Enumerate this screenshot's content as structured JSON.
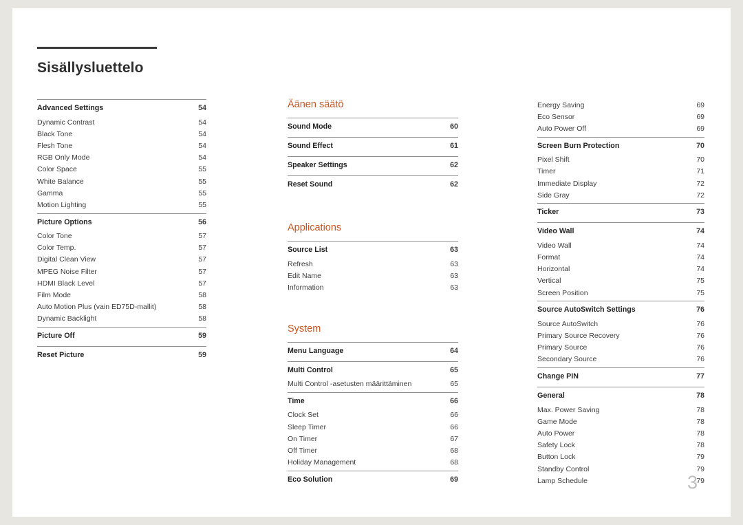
{
  "document": {
    "title": "Sisällysluettelo",
    "page_number": "3"
  },
  "columns": [
    {
      "sections": [
        {
          "heading": null,
          "blocks": [
            {
              "rows": [
                {
                  "label": "Advanced Settings",
                  "page": "54",
                  "bold": true
                },
                {
                  "label": "Dynamic Contrast",
                  "page": "54",
                  "bold": false
                },
                {
                  "label": "Black Tone",
                  "page": "54",
                  "bold": false
                },
                {
                  "label": "Flesh Tone",
                  "page": "54",
                  "bold": false
                },
                {
                  "label": "RGB Only Mode",
                  "page": "54",
                  "bold": false
                },
                {
                  "label": "Color Space",
                  "page": "55",
                  "bold": false
                },
                {
                  "label": "White Balance",
                  "page": "55",
                  "bold": false
                },
                {
                  "label": "Gamma",
                  "page": "55",
                  "bold": false
                },
                {
                  "label": "Motion Lighting",
                  "page": "55",
                  "bold": false
                }
              ]
            },
            {
              "rows": [
                {
                  "label": "Picture Options",
                  "page": "56",
                  "bold": true
                },
                {
                  "label": "Color Tone",
                  "page": "57",
                  "bold": false
                },
                {
                  "label": "Color Temp.",
                  "page": "57",
                  "bold": false
                },
                {
                  "label": "Digital Clean View",
                  "page": "57",
                  "bold": false
                },
                {
                  "label": "MPEG Noise Filter",
                  "page": "57",
                  "bold": false
                },
                {
                  "label": "HDMI Black Level",
                  "page": "57",
                  "bold": false
                },
                {
                  "label": "Film Mode",
                  "page": "58",
                  "bold": false
                },
                {
                  "label": "Auto Motion Plus (vain ED75D-mallit)",
                  "page": "58",
                  "bold": false
                },
                {
                  "label": "Dynamic Backlight",
                  "page": "58",
                  "bold": false
                }
              ]
            },
            {
              "rows": [
                {
                  "label": "Picture Off",
                  "page": "59",
                  "bold": true
                }
              ]
            },
            {
              "rows": [
                {
                  "label": "Reset Picture",
                  "page": "59",
                  "bold": true
                }
              ]
            }
          ]
        }
      ]
    },
    {
      "sections": [
        {
          "heading": "Äänen säätö",
          "blocks": [
            {
              "rows": [
                {
                  "label": "Sound Mode",
                  "page": "60",
                  "bold": true
                }
              ]
            },
            {
              "rows": [
                {
                  "label": "Sound Effect",
                  "page": "61",
                  "bold": true
                }
              ]
            },
            {
              "rows": [
                {
                  "label": "Speaker Settings",
                  "page": "62",
                  "bold": true
                }
              ]
            },
            {
              "rows": [
                {
                  "label": "Reset Sound",
                  "page": "62",
                  "bold": true
                }
              ]
            }
          ]
        },
        {
          "heading": "Applications",
          "blocks": [
            {
              "rows": [
                {
                  "label": "Source List",
                  "page": "63",
                  "bold": true
                },
                {
                  "label": "Refresh",
                  "page": "63",
                  "bold": false
                },
                {
                  "label": "Edit Name",
                  "page": "63",
                  "bold": false
                },
                {
                  "label": "Information",
                  "page": "63",
                  "bold": false
                }
              ]
            }
          ]
        },
        {
          "heading": "System",
          "blocks": [
            {
              "rows": [
                {
                  "label": "Menu Language",
                  "page": "64",
                  "bold": true
                }
              ]
            },
            {
              "rows": [
                {
                  "label": "Multi Control",
                  "page": "65",
                  "bold": true
                },
                {
                  "label": "Multi Control -asetusten määrittäminen",
                  "page": "65",
                  "bold": false
                }
              ]
            },
            {
              "rows": [
                {
                  "label": "Time",
                  "page": "66",
                  "bold": true
                },
                {
                  "label": "Clock Set",
                  "page": "66",
                  "bold": false
                },
                {
                  "label": "Sleep Timer",
                  "page": "66",
                  "bold": false
                },
                {
                  "label": "On Timer",
                  "page": "67",
                  "bold": false
                },
                {
                  "label": "Off Timer",
                  "page": "68",
                  "bold": false
                },
                {
                  "label": "Holiday Management",
                  "page": "68",
                  "bold": false
                }
              ]
            },
            {
              "rows": [
                {
                  "label": "Eco Solution",
                  "page": "69",
                  "bold": true
                }
              ]
            }
          ]
        }
      ]
    },
    {
      "sections": [
        {
          "heading": null,
          "blocks": [
            {
              "no_top_rule": true,
              "rows": [
                {
                  "label": "Energy Saving",
                  "page": "69",
                  "bold": false
                },
                {
                  "label": "Eco Sensor",
                  "page": "69",
                  "bold": false
                },
                {
                  "label": "Auto Power Off",
                  "page": "69",
                  "bold": false
                }
              ]
            },
            {
              "rows": [
                {
                  "label": "Screen Burn Protection",
                  "page": "70",
                  "bold": true
                },
                {
                  "label": "Pixel Shift",
                  "page": "70",
                  "bold": false
                },
                {
                  "label": "Timer",
                  "page": "71",
                  "bold": false
                },
                {
                  "label": "Immediate Display",
                  "page": "72",
                  "bold": false
                },
                {
                  "label": "Side Gray",
                  "page": "72",
                  "bold": false
                }
              ]
            },
            {
              "rows": [
                {
                  "label": "Ticker",
                  "page": "73",
                  "bold": true
                }
              ]
            },
            {
              "rows": [
                {
                  "label": "Video Wall",
                  "page": "74",
                  "bold": true
                },
                {
                  "label": "Video Wall",
                  "page": "74",
                  "bold": false
                },
                {
                  "label": "Format",
                  "page": "74",
                  "bold": false
                },
                {
                  "label": "Horizontal",
                  "page": "74",
                  "bold": false
                },
                {
                  "label": "Vertical",
                  "page": "75",
                  "bold": false
                },
                {
                  "label": "Screen Position",
                  "page": "75",
                  "bold": false
                }
              ]
            },
            {
              "rows": [
                {
                  "label": "Source AutoSwitch Settings",
                  "page": "76",
                  "bold": true
                },
                {
                  "label": "Source AutoSwitch",
                  "page": "76",
                  "bold": false
                },
                {
                  "label": "Primary Source Recovery",
                  "page": "76",
                  "bold": false
                },
                {
                  "label": "Primary Source",
                  "page": "76",
                  "bold": false
                },
                {
                  "label": "Secondary Source",
                  "page": "76",
                  "bold": false
                }
              ]
            },
            {
              "rows": [
                {
                  "label": "Change PIN",
                  "page": "77",
                  "bold": true
                }
              ]
            },
            {
              "rows": [
                {
                  "label": "General",
                  "page": "78",
                  "bold": true
                },
                {
                  "label": "Max. Power Saving",
                  "page": "78",
                  "bold": false
                },
                {
                  "label": "Game Mode",
                  "page": "78",
                  "bold": false
                },
                {
                  "label": "Auto Power",
                  "page": "78",
                  "bold": false
                },
                {
                  "label": "Safety Lock",
                  "page": "78",
                  "bold": false
                },
                {
                  "label": "Button Lock",
                  "page": "79",
                  "bold": false
                },
                {
                  "label": "Standby Control",
                  "page": "79",
                  "bold": false
                },
                {
                  "label": "Lamp Schedule",
                  "page": "79",
                  "bold": false
                }
              ]
            }
          ]
        }
      ]
    }
  ]
}
